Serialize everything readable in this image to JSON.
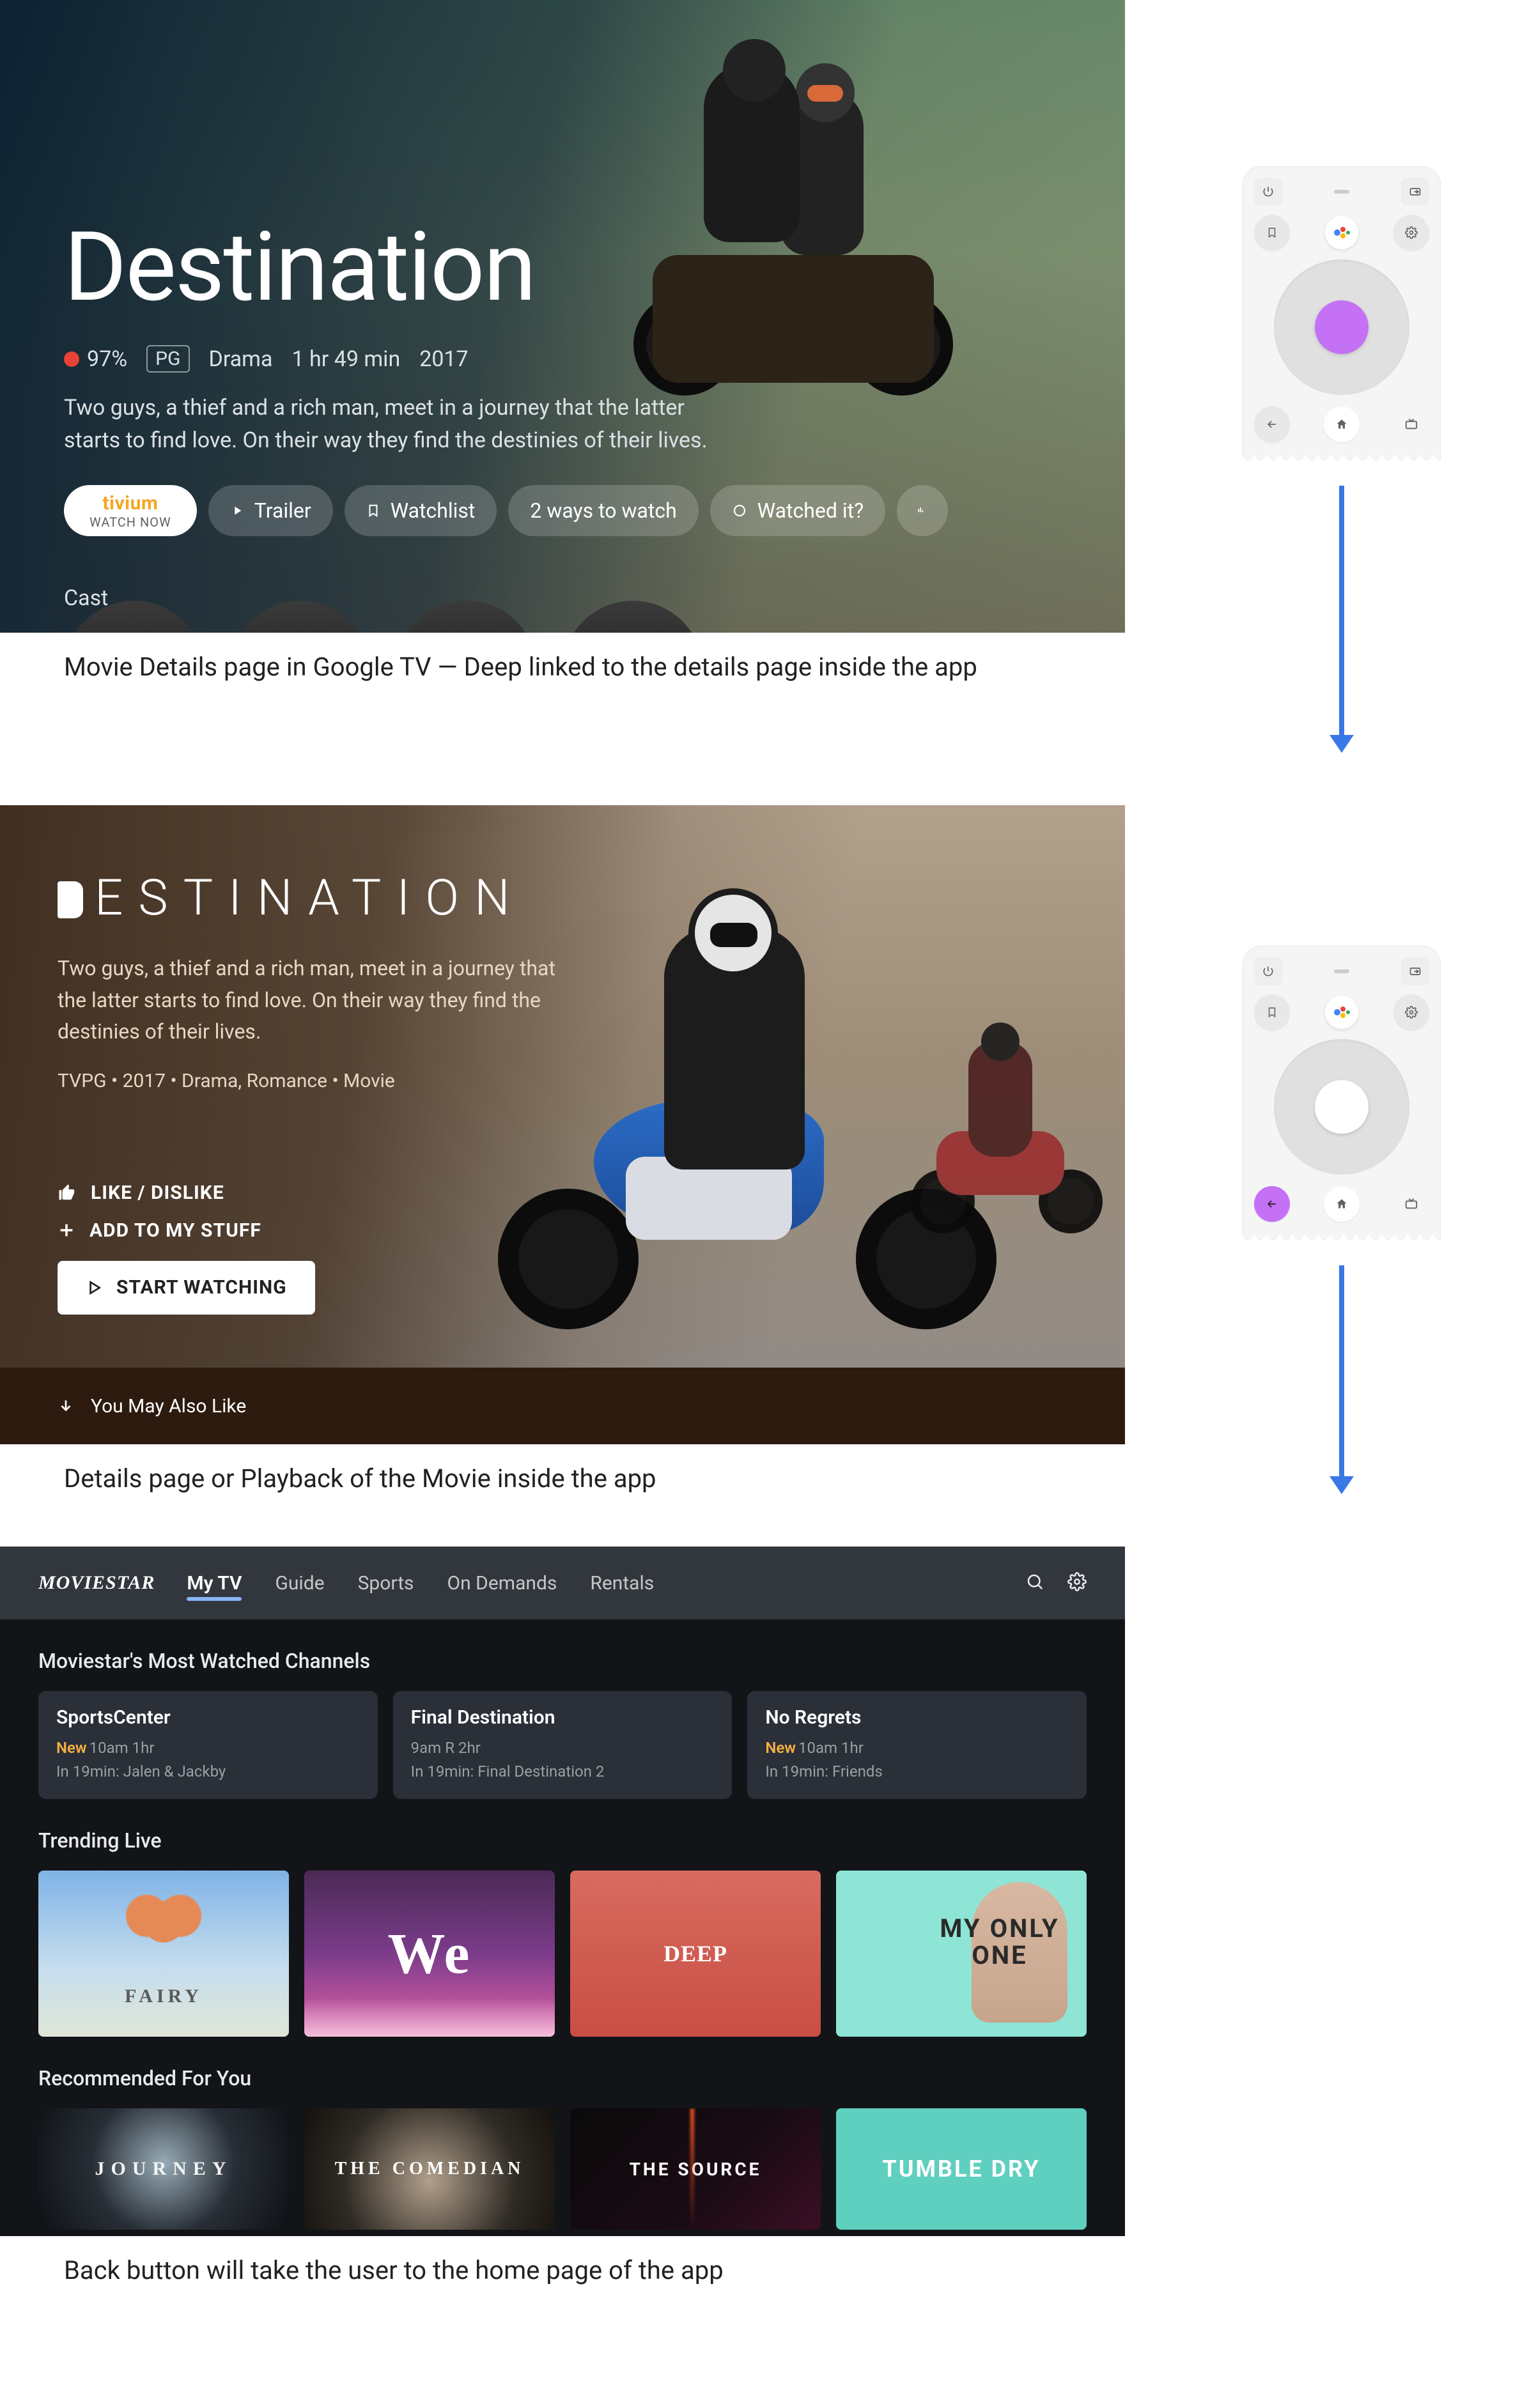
{
  "captions": {
    "c1": "Movie Details page in Google TV — Deep linked to the details page inside the app",
    "c2": "Details page or Playback of the Movie inside the app",
    "c3": "Back button will take the user to the home page of the app"
  },
  "googleTv": {
    "title": "Destination",
    "score": "97%",
    "rating": "PG",
    "genre": "Drama",
    "duration": "1 hr 49 min",
    "year": "2017",
    "description": "Two guys, a thief and a rich man, meet in a journey that the latter starts to find love. On their way they find the destinies of their lives.",
    "watchNow": {
      "brand": "tivium",
      "sub": "WATCH NOW"
    },
    "actions": {
      "trailer": "Trailer",
      "watchlist": "Watchlist",
      "ways": "2 ways to watch",
      "watched": "Watched it?"
    },
    "castLabel": "Cast"
  },
  "appDetails": {
    "title": "ESTINATION",
    "description": "Two guys, a thief and a rich man, meet in a journey that the latter starts to find love. On their way they find the destinies of their lives.",
    "meta": "TVPG • 2017 • Drama, Romance • Movie",
    "like": "LIKE / DISLIKE",
    "add": "ADD TO MY STUFF",
    "start": "START WATCHING",
    "also": "You May Also Like"
  },
  "moviestar": {
    "logo": "MOVIESTAR",
    "tabs": [
      "My TV",
      "Guide",
      "Sports",
      "On Demands",
      "Rentals"
    ],
    "activeTab": 0,
    "sections": {
      "mostWatched": "Moviestar's Most Watched Channels",
      "trending": "Trending Live",
      "recommended": "Recommended For You"
    },
    "cards": [
      {
        "title": "SportsCenter",
        "isNew": true,
        "time": "10am 1hr",
        "next": "In 19min: Jalen & Jackby"
      },
      {
        "title": "Final Destination",
        "isNew": false,
        "time": "9am R 2hr",
        "next": "In 19min: Final Destination 2"
      },
      {
        "title": "No Regrets",
        "isNew": true,
        "time": "10am 1hr",
        "next": "In 19min: Friends"
      }
    ],
    "trendingThumbs": [
      "FAIRY",
      "We",
      "DEEP",
      "MY\nONLY\nONE"
    ],
    "recommendedThumbs": [
      "JOURNEY",
      "THE COMEDIAN",
      "THE SOURCE",
      "TUMBLE\nDRY"
    ],
    "newLabel": "New"
  },
  "remote": {
    "buttons": {
      "power": "power",
      "input": "input",
      "bookmark": "bookmark",
      "assistant": "assistant",
      "settings": "settings",
      "back": "back",
      "home": "home",
      "tv": "tv"
    }
  }
}
